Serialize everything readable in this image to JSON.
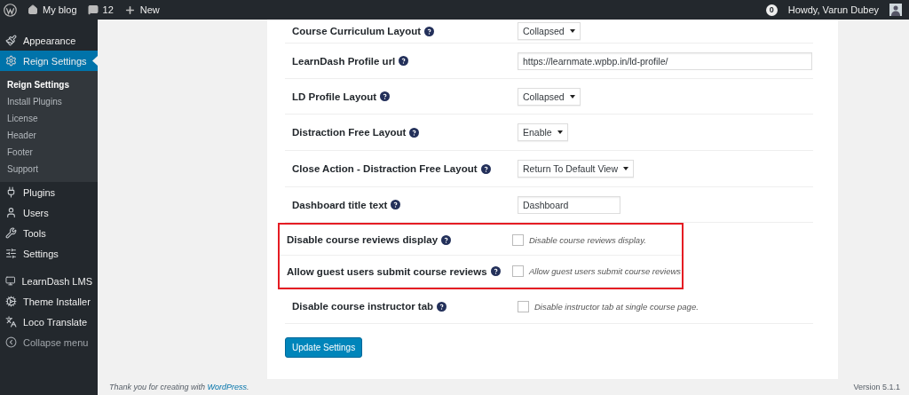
{
  "admin_bar": {
    "site": "My blog",
    "comments": "12",
    "new": "New",
    "notifications": "0",
    "greeting": "Howdy, Varun Dubey"
  },
  "sidebar": {
    "menu_groups": [
      {
        "items": [
          {
            "label": "Appearance",
            "selected": false
          },
          {
            "label": "Reign Settings",
            "selected": true,
            "children": [
              {
                "label": "Reign Settings",
                "selected": true
              },
              {
                "label": "Install Plugins",
                "selected": false
              },
              {
                "label": "License",
                "selected": false
              },
              {
                "label": "Header",
                "selected": false
              },
              {
                "label": "Footer",
                "selected": false
              },
              {
                "label": "Support",
                "selected": false
              }
            ]
          },
          {
            "label": "Plugins",
            "selected": false
          },
          {
            "label": "Users",
            "selected": false
          },
          {
            "label": "Tools",
            "selected": false
          },
          {
            "label": "Settings",
            "selected": false
          }
        ]
      },
      {
        "items": [
          {
            "label": "LearnDash LMS",
            "selected": false
          },
          {
            "label": "Theme Installer",
            "selected": false
          },
          {
            "label": "Loco Translate",
            "selected": false
          },
          {
            "label": "Collapse menu",
            "selected": false,
            "kind": "collapse"
          }
        ]
      }
    ]
  },
  "settings": {
    "rows": [
      {
        "label": "Course Curriculum Layout",
        "kind": "select",
        "value": "Collapsed",
        "highlighted": false
      },
      {
        "label": "LearnDash Profile url",
        "kind": "text",
        "value": "https://learnmate.wpbp.in/ld-profile/",
        "highlighted": false
      },
      {
        "label": "LD Profile Layout",
        "kind": "select",
        "value": "Collapsed",
        "highlighted": false
      },
      {
        "label": "Distraction Free Layout",
        "kind": "select",
        "value": "Enable",
        "highlighted": false
      },
      {
        "label": "Close Action - Distraction Free Layout",
        "kind": "select",
        "value": "Return To Default View",
        "highlighted": false
      },
      {
        "label": "Dashboard title text",
        "kind": "text",
        "value": "Dashboard",
        "highlighted": false
      },
      {
        "label": "Disable course reviews display",
        "kind": "checkbox",
        "description": "Disable course reviews display.",
        "checked": false,
        "highlighted": true
      },
      {
        "label": "Allow guest users submit course reviews",
        "kind": "checkbox",
        "description": "Allow guest users submit course reviews",
        "checked": false,
        "highlighted": true
      },
      {
        "label": "Disable course instructor tab",
        "kind": "checkbox",
        "description": "Disable instructor tab at single course page.",
        "checked": false,
        "highlighted": false
      }
    ],
    "submit": "Update Settings"
  },
  "footer": {
    "thanks": "Thank you for creating with ",
    "link": "WordPress",
    "thanks_end": ".",
    "version": "Version 5.1.1"
  }
}
